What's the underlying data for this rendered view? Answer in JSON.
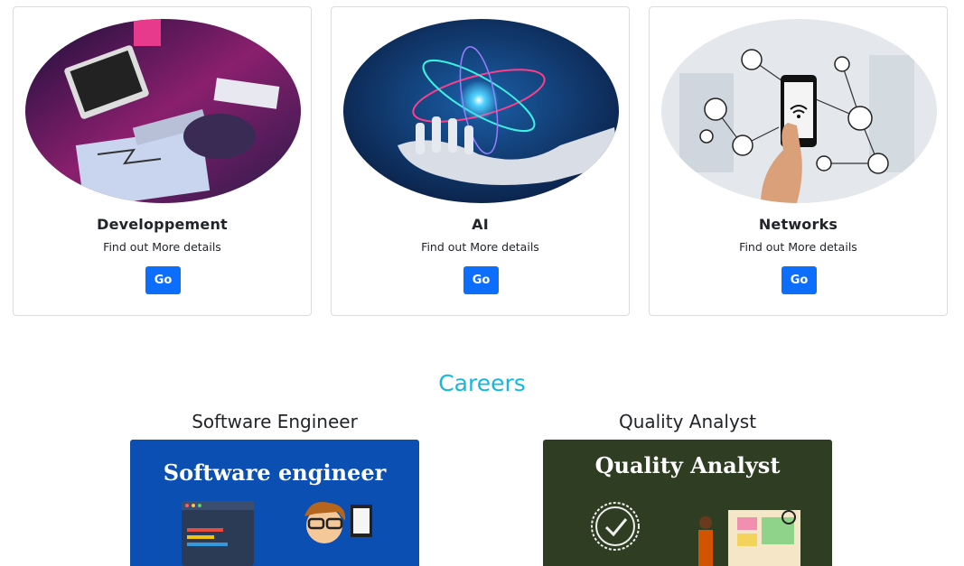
{
  "cards": [
    {
      "title": "Developpement",
      "desc": "Find out More details",
      "button": "Go",
      "image": "coding-desk-illustration"
    },
    {
      "title": "AI",
      "desc": "Find out More details",
      "button": "Go",
      "image": "robot-hand-atom-illustration"
    },
    {
      "title": "Networks",
      "desc": "Find out More details",
      "button": "Go",
      "image": "phone-network-illustration"
    }
  ],
  "careers": {
    "heading": "Careers",
    "jobs": [
      {
        "title": "Software Engineer",
        "banner_text": "Software engineer",
        "banner_color": "#0b4fb3"
      },
      {
        "title": "Quality Analyst",
        "banner_text": "Quality  Analyst",
        "banner_color": "#2f3d22"
      }
    ]
  },
  "colors": {
    "accent": "#0d6efd",
    "heading": "#17b6e0"
  }
}
